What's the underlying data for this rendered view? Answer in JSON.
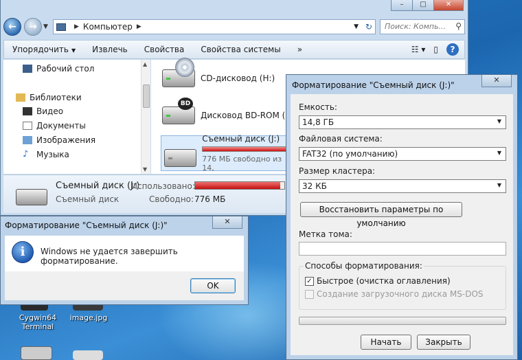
{
  "explorer": {
    "breadcrumb": "Компьютер",
    "search_placeholder": "Поиск: Компь...",
    "toolbar": {
      "organize": "Упорядочить",
      "eject": "Извлечь",
      "properties": "Свойства",
      "system_properties": "Свойства системы",
      "more": "»"
    },
    "nav": {
      "desktop": "Рабочий стол",
      "libraries": "Библиотеки",
      "video": "Видео",
      "documents": "Документы",
      "images": "Изображения",
      "music": "Музыка"
    },
    "files": [
      {
        "name": "CD-дисковод (H:)"
      },
      {
        "name": "Дисковод BD-ROM (I:)"
      },
      {
        "name": "Съемный диск (J:)",
        "free": "776 МБ свободно из 14,"
      }
    ],
    "details": {
      "name": "Съемный диск (J:)",
      "type": "Съемный диск",
      "used_label": "Использовано:",
      "free_label": "Свободно:",
      "free_value": "776 МБ",
      "used_fraction": 0.95
    }
  },
  "error_dialog": {
    "title": "Форматирование \"Съемный диск (J:)\"",
    "message": "Windows не удается завершить форматирование.",
    "ok": "OK"
  },
  "format_dialog": {
    "title": "Форматирование \"Съемный диск (J:)\"",
    "capacity_label": "Емкость:",
    "capacity_value": "14,8 ГБ",
    "fs_label": "Файловая система:",
    "fs_value": "FAT32 (по умолчанию)",
    "cluster_label": "Размер кластера:",
    "cluster_value": "32 КБ",
    "restore_defaults": "Восстановить параметры по умолчанию",
    "volume_label": "Метка тома:",
    "volume_value": "",
    "options_label": "Способы форматирования:",
    "quick_format": "Быстрое (очистка оглавления)",
    "quick_checked": true,
    "boot_disk": "Создание загрузочного диска MS-DOS",
    "start": "Начать",
    "close": "Закрыть"
  },
  "desktop": {
    "icons": [
      {
        "label": "Cygwin64\nTerminal"
      },
      {
        "label": "image.jpg"
      }
    ]
  }
}
